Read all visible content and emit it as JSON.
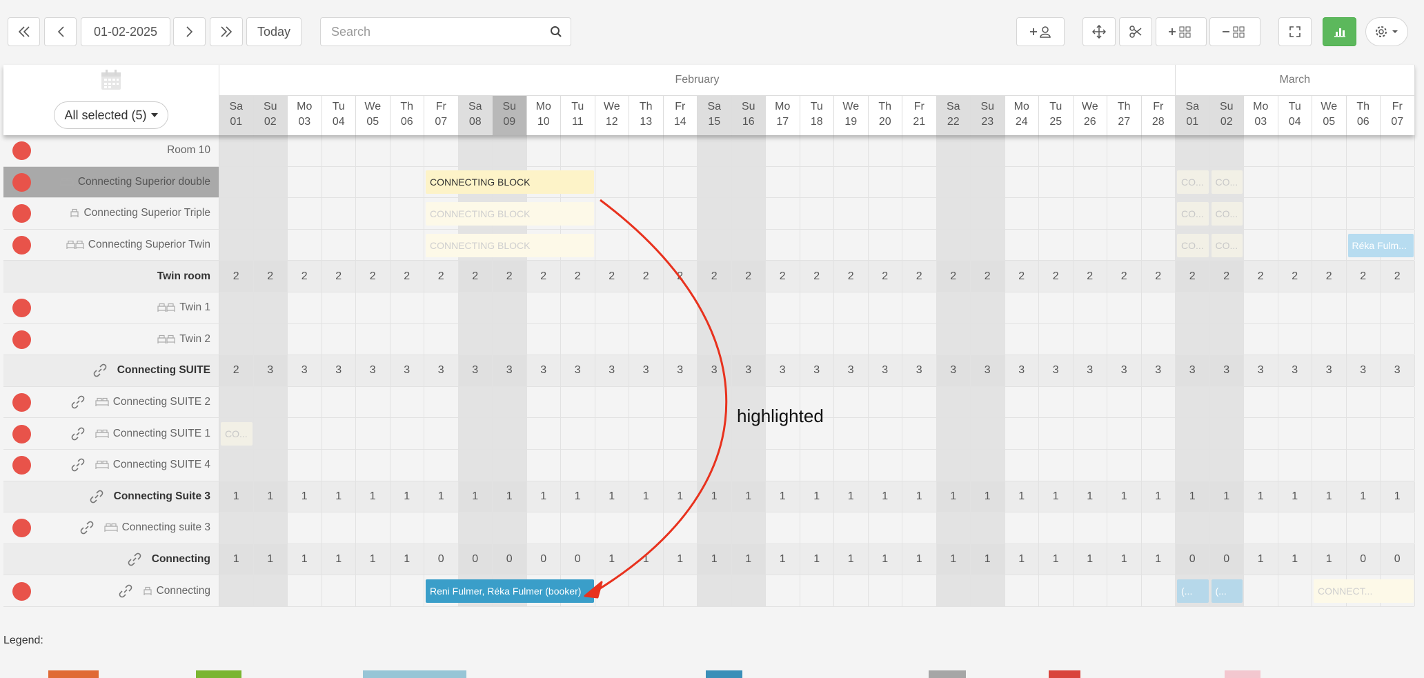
{
  "toolbar": {
    "date": "01-02-2025",
    "today_label": "Today",
    "search_placeholder": "Search"
  },
  "calendar": {
    "filter_label": "All selected (5)",
    "months": [
      {
        "name": "February",
        "start": 0,
        "span": 28
      },
      {
        "name": "March",
        "start": 28,
        "span": 7
      }
    ],
    "selected_day_index": 8,
    "days": [
      {
        "d": "Sa",
        "n": "01",
        "we": true
      },
      {
        "d": "Su",
        "n": "02",
        "we": true
      },
      {
        "d": "Mo",
        "n": "03"
      },
      {
        "d": "Tu",
        "n": "04"
      },
      {
        "d": "We",
        "n": "05"
      },
      {
        "d": "Th",
        "n": "06"
      },
      {
        "d": "Fr",
        "n": "07"
      },
      {
        "d": "Sa",
        "n": "08",
        "we": true
      },
      {
        "d": "Su",
        "n": "09",
        "we": true
      },
      {
        "d": "Mo",
        "n": "10"
      },
      {
        "d": "Tu",
        "n": "11"
      },
      {
        "d": "We",
        "n": "12"
      },
      {
        "d": "Th",
        "n": "13"
      },
      {
        "d": "Fr",
        "n": "14"
      },
      {
        "d": "Sa",
        "n": "15",
        "we": true
      },
      {
        "d": "Su",
        "n": "16",
        "we": true
      },
      {
        "d": "Mo",
        "n": "17"
      },
      {
        "d": "Tu",
        "n": "18"
      },
      {
        "d": "We",
        "n": "19"
      },
      {
        "d": "Th",
        "n": "20"
      },
      {
        "d": "Fr",
        "n": "21"
      },
      {
        "d": "Sa",
        "n": "22",
        "we": true
      },
      {
        "d": "Su",
        "n": "23",
        "we": true
      },
      {
        "d": "Mo",
        "n": "24"
      },
      {
        "d": "Tu",
        "n": "25"
      },
      {
        "d": "We",
        "n": "26"
      },
      {
        "d": "Th",
        "n": "27"
      },
      {
        "d": "Fr",
        "n": "28"
      },
      {
        "d": "Sa",
        "n": "01",
        "we": true
      },
      {
        "d": "Su",
        "n": "02",
        "we": true
      },
      {
        "d": "Mo",
        "n": "03"
      },
      {
        "d": "Tu",
        "n": "04"
      },
      {
        "d": "We",
        "n": "05"
      },
      {
        "d": "Th",
        "n": "06"
      },
      {
        "d": "Fr",
        "n": "07"
      }
    ],
    "rows": [
      {
        "label": "Room 10",
        "type": "room",
        "dot": true,
        "icon": ""
      },
      {
        "label": "Connecting Superior double",
        "type": "room",
        "dot": true,
        "icon": "double-bed-icon",
        "highlighted": true
      },
      {
        "label": "Connecting Superior Triple",
        "type": "room",
        "dot": true,
        "icon": "single-bed-icon"
      },
      {
        "label": "Connecting Superior Twin",
        "type": "room",
        "dot": true,
        "icon": "twin-bed-icon"
      },
      {
        "label": "Twin room",
        "type": "sum",
        "values": [
          2,
          2,
          2,
          2,
          2,
          2,
          2,
          2,
          2,
          2,
          2,
          2,
          2,
          2,
          2,
          2,
          2,
          2,
          2,
          2,
          2,
          2,
          2,
          2,
          2,
          2,
          2,
          2,
          2,
          2,
          2,
          2,
          2,
          2,
          2
        ]
      },
      {
        "label": "Twin 1",
        "type": "room",
        "dot": true,
        "icon": "twin-bed-icon"
      },
      {
        "label": "Twin 2",
        "type": "room",
        "dot": true,
        "icon": "twin-bed-icon"
      },
      {
        "label": "Connecting SUITE",
        "type": "sum",
        "link": true,
        "values": [
          2,
          3,
          3,
          3,
          3,
          3,
          3,
          3,
          3,
          3,
          3,
          3,
          3,
          3,
          3,
          3,
          3,
          3,
          3,
          3,
          3,
          3,
          3,
          3,
          3,
          3,
          3,
          3,
          3,
          3,
          3,
          3,
          3,
          3,
          3
        ]
      },
      {
        "label": "Connecting SUITE 2",
        "type": "room",
        "dot": true,
        "link": true,
        "icon": "double-bed-icon"
      },
      {
        "label": "Connecting SUITE 1",
        "type": "room",
        "dot": true,
        "link": true,
        "icon": "double-bed-icon"
      },
      {
        "label": "Connecting SUITE 4",
        "type": "room",
        "dot": true,
        "link": true,
        "icon": "double-bed-icon"
      },
      {
        "label": "Connecting Suite 3",
        "type": "sum",
        "link": true,
        "values": [
          1,
          1,
          1,
          1,
          1,
          1,
          1,
          1,
          1,
          1,
          1,
          1,
          1,
          1,
          1,
          1,
          1,
          1,
          1,
          1,
          1,
          1,
          1,
          1,
          1,
          1,
          1,
          1,
          1,
          1,
          1,
          1,
          1,
          1,
          1
        ]
      },
      {
        "label": "Connecting suite 3",
        "type": "room",
        "dot": true,
        "link": true,
        "icon": "double-bed-icon"
      },
      {
        "label": "Connecting",
        "type": "sum",
        "link": true,
        "values": [
          1,
          1,
          1,
          1,
          1,
          1,
          0,
          0,
          0,
          0,
          0,
          1,
          1,
          1,
          1,
          1,
          1,
          1,
          1,
          1,
          1,
          1,
          1,
          1,
          1,
          1,
          1,
          1,
          0,
          0,
          1,
          1,
          1,
          0,
          0
        ]
      },
      {
        "label": "Connecting",
        "type": "room",
        "dot": true,
        "link": true,
        "icon": "single-bed-icon"
      }
    ],
    "blocks": [
      {
        "row": 1,
        "start": 6,
        "span": 5,
        "text": "CONNECTING BLOCK",
        "style": "yellow"
      },
      {
        "row": 2,
        "start": 6,
        "span": 5,
        "text": "CONNECTING BLOCK",
        "style": "yellow-faint"
      },
      {
        "row": 3,
        "start": 6,
        "span": 5,
        "text": "CONNECTING BLOCK",
        "style": "yellow-faint"
      },
      {
        "row": 1,
        "start": 28,
        "span": 1,
        "text": "CO...",
        "style": "gray-faint"
      },
      {
        "row": 1,
        "start": 29,
        "span": 1,
        "text": "CO...",
        "style": "gray-faint"
      },
      {
        "row": 2,
        "start": 28,
        "span": 1,
        "text": "CO...",
        "style": "gray-faint"
      },
      {
        "row": 2,
        "start": 29,
        "span": 1,
        "text": "CO...",
        "style": "gray-faint"
      },
      {
        "row": 3,
        "start": 28,
        "span": 1,
        "text": "CO...",
        "style": "gray-faint"
      },
      {
        "row": 3,
        "start": 29,
        "span": 1,
        "text": "CO...",
        "style": "gray-faint"
      },
      {
        "row": 3,
        "start": 33,
        "span": 2,
        "text": "Réka Fulm...",
        "style": "lightblue"
      },
      {
        "row": 9,
        "start": 0,
        "span": 1,
        "text": "CO...",
        "style": "gray-faint"
      },
      {
        "row": 14,
        "start": 6,
        "span": 5,
        "text": "Reni Fulmer, Réka Fulmer (booker)",
        "style": "blue"
      },
      {
        "row": 14,
        "start": 28,
        "span": 1,
        "text": "(...",
        "style": "bluepale"
      },
      {
        "row": 14,
        "start": 29,
        "span": 1,
        "text": "(...",
        "style": "bluepale"
      },
      {
        "row": 14,
        "start": 32,
        "span": 3,
        "text": "CONNECT...",
        "style": "yellow-faint"
      }
    ]
  },
  "annotation": {
    "text": "highlighted"
  },
  "legend": {
    "title": "Legend:",
    "swatches": [
      "#e06a35",
      "#7ab530",
      "#97c5d6",
      "#3a8fb8",
      "#a6a6a6",
      "#d9443c",
      "#f3c7cf"
    ]
  }
}
